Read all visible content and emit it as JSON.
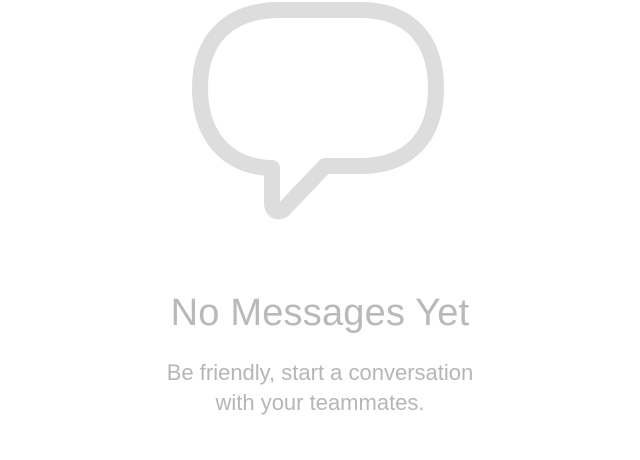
{
  "empty_state": {
    "icon": "speech-bubble-icon",
    "icon_color": "#dddddd",
    "title": "No Messages Yet",
    "subtitle_line1": "Be friendly, start a conversation",
    "subtitle_line2": "with your teammates.",
    "title_color": "#b9b9b9",
    "subtitle_color": "#b6b6b6"
  }
}
